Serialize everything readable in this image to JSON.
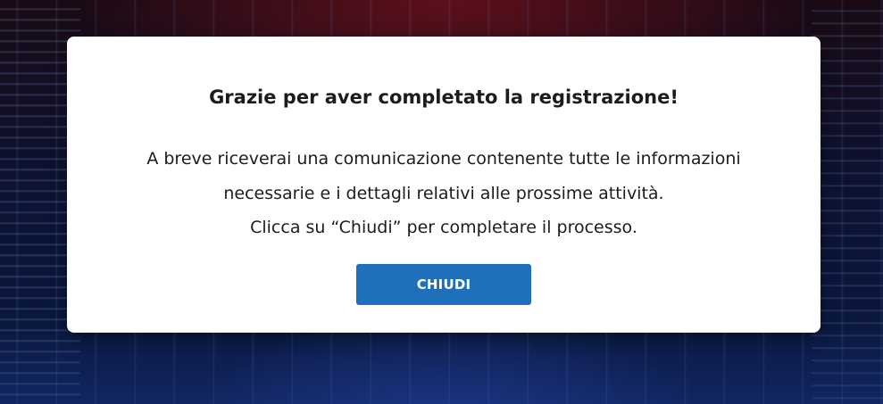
{
  "dialog": {
    "title": "Grazie per aver completato la registrazione!",
    "body_lines": [
      "A breve riceverai una comunicazione contenente tutte le informazioni",
      "necessarie e i dettagli relativi alle prossime attività.",
      "Clicca su “Chiudi” per completare il processo."
    ],
    "close_button_label": "CHIUDI"
  },
  "colors": {
    "button_background": "#1f6fba",
    "button_text": "#ffffff",
    "dialog_background": "#ffffff",
    "text": "#1c1c1c"
  }
}
